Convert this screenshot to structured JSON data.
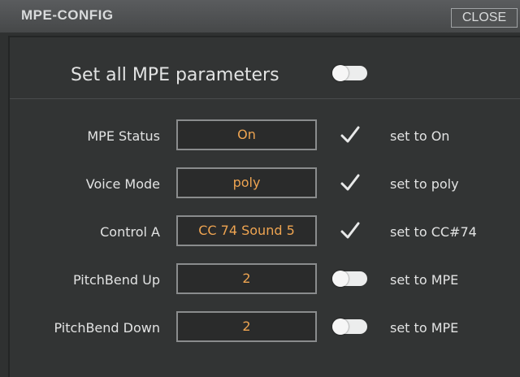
{
  "window": {
    "title": "MPE-CONFIG",
    "close_label": "CLOSE"
  },
  "set_all": {
    "label": "Set all MPE parameters",
    "toggle_on": false
  },
  "rows": [
    {
      "label": "MPE Status",
      "value": "On",
      "indicator": "checkmark-icon",
      "status": "set to On"
    },
    {
      "label": "Voice Mode",
      "value": "poly",
      "indicator": "checkmark-icon",
      "status": "set to poly"
    },
    {
      "label": "Control A",
      "value": "CC 74 Sound 5",
      "indicator": "checkmark-icon",
      "status": "set to CC#74"
    },
    {
      "label": "PitchBend Up",
      "value": "2",
      "indicator": "toggle-off",
      "status": "set to MPE"
    },
    {
      "label": "PitchBend Down",
      "value": "2",
      "indicator": "toggle-off",
      "status": "set to MPE"
    }
  ],
  "colors": {
    "value_text": "#eea451",
    "background": "#2f3131",
    "label_text": "#e2e3e3"
  }
}
